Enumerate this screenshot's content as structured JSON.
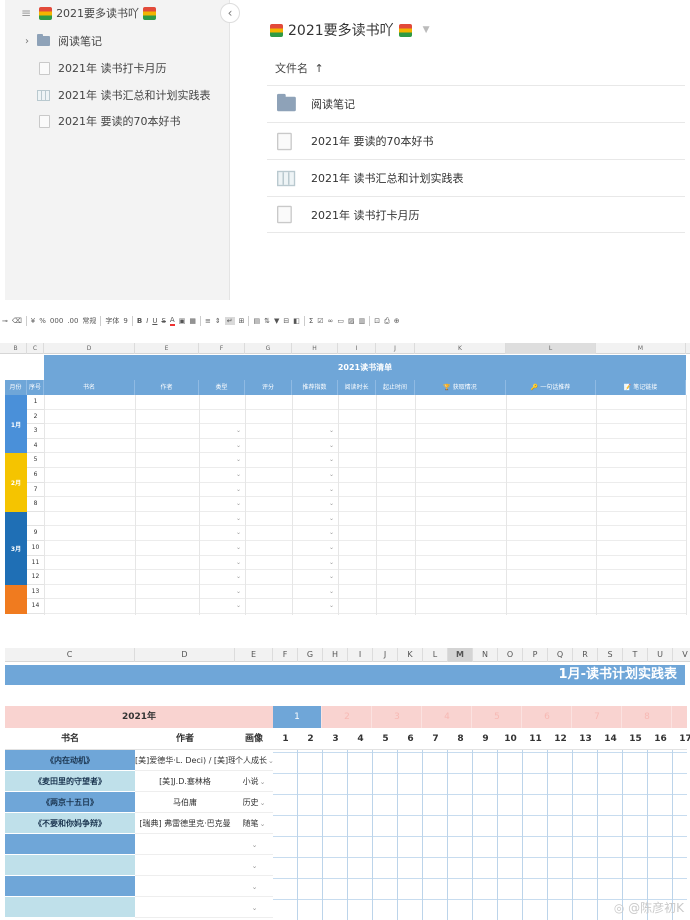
{
  "browser": {
    "sidebar": {
      "root_label": "2021要多读书吖",
      "items": [
        {
          "label": "阅读笔记",
          "icon": "folder-icon"
        },
        {
          "label": "2021年 读书打卡月历",
          "icon": "doc-icon"
        },
        {
          "label": "2021年 读书汇总和计划实践表",
          "icon": "sheet-icon"
        },
        {
          "label": "2021年 要读的70本好书",
          "icon": "doc-icon"
        }
      ]
    },
    "title": "2021要多读书吖",
    "column_header": "文件名",
    "files": [
      {
        "label": "阅读笔记",
        "icon": "folder-icon"
      },
      {
        "label": "2021年 要读的70本好书",
        "icon": "doc-icon"
      },
      {
        "label": "2021年 读书汇总和计划实践表",
        "icon": "sheet-icon"
      },
      {
        "label": "2021年 读书打卡月历",
        "icon": "doc-icon"
      }
    ]
  },
  "sheet": {
    "toolbar": [
      "¥",
      "%",
      "000",
      ".00",
      "常规",
      "字体",
      "9",
      "B",
      "I",
      "U",
      "S",
      "A",
      "Σ"
    ],
    "col_headers": [
      "B",
      "C",
      "D",
      "E",
      "F",
      "G",
      "H",
      "I",
      "J",
      "K",
      "L",
      "M"
    ],
    "title": "2021读书清单",
    "headers": [
      "月份",
      "序号",
      "书名",
      "作者",
      "类型",
      "评分",
      "推荐指数",
      "阅读时长",
      "起止时间",
      "获取情况",
      "一句话推荐",
      "笔记链接"
    ],
    "row_numbers": [
      "1",
      "2",
      "3",
      "4",
      "5",
      "6",
      "7",
      "8",
      "",
      "9",
      "10",
      "11",
      "12",
      "13",
      "14"
    ],
    "months": [
      {
        "label": "1月",
        "color": "#4a90d9"
      },
      {
        "label": "2月",
        "color": "#f5c400"
      },
      {
        "label": "3月",
        "color": "#1f6fb5"
      },
      {
        "label": "",
        "color": "#f07b1f"
      }
    ]
  },
  "plan": {
    "col_headers": [
      "C",
      "D",
      "E",
      "F",
      "G",
      "H",
      "I",
      "J",
      "K",
      "L",
      "M",
      "N",
      "O",
      "P",
      "Q",
      "R",
      "S",
      "T",
      "U",
      "V"
    ],
    "title": "1月-读书计划实践表",
    "year_label": "2021年",
    "month_numbers": [
      "1",
      "2",
      "3",
      "4",
      "5",
      "6",
      "7",
      "8"
    ],
    "header_labels": {
      "book": "书名",
      "author": "作者",
      "type": "画像"
    },
    "day_numbers": [
      "1",
      "2",
      "3",
      "4",
      "5",
      "6",
      "7",
      "8",
      "9",
      "10",
      "11",
      "12",
      "13",
      "14",
      "15",
      "16",
      "17"
    ],
    "books": [
      {
        "title": "《内在动机》",
        "author": "[美]爱德华·L. Deci) / [美]理查德·弗",
        "type": "个人成长"
      },
      {
        "title": "《麦田里的守望者》",
        "author": "[美]J.D.塞林格",
        "type": "小说"
      },
      {
        "title": "《两京十五日》",
        "author": "马伯庸",
        "type": "历史"
      },
      {
        "title": "《不要和你妈争辩》",
        "author": "[瑞典] 弗雷德里克·巴克曼",
        "type": "随笔"
      },
      {
        "title": "",
        "author": "",
        "type": ""
      },
      {
        "title": "",
        "author": "",
        "type": ""
      },
      {
        "title": "",
        "author": "",
        "type": ""
      },
      {
        "title": "",
        "author": "",
        "type": ""
      }
    ],
    "watermark": "@陈彦初K"
  },
  "colors": {
    "sheet_blue": "#6fa6d8",
    "pink": "#f9d3d0",
    "month_active": "#6fa6d8",
    "month_inactive": "#f7b9b4"
  }
}
